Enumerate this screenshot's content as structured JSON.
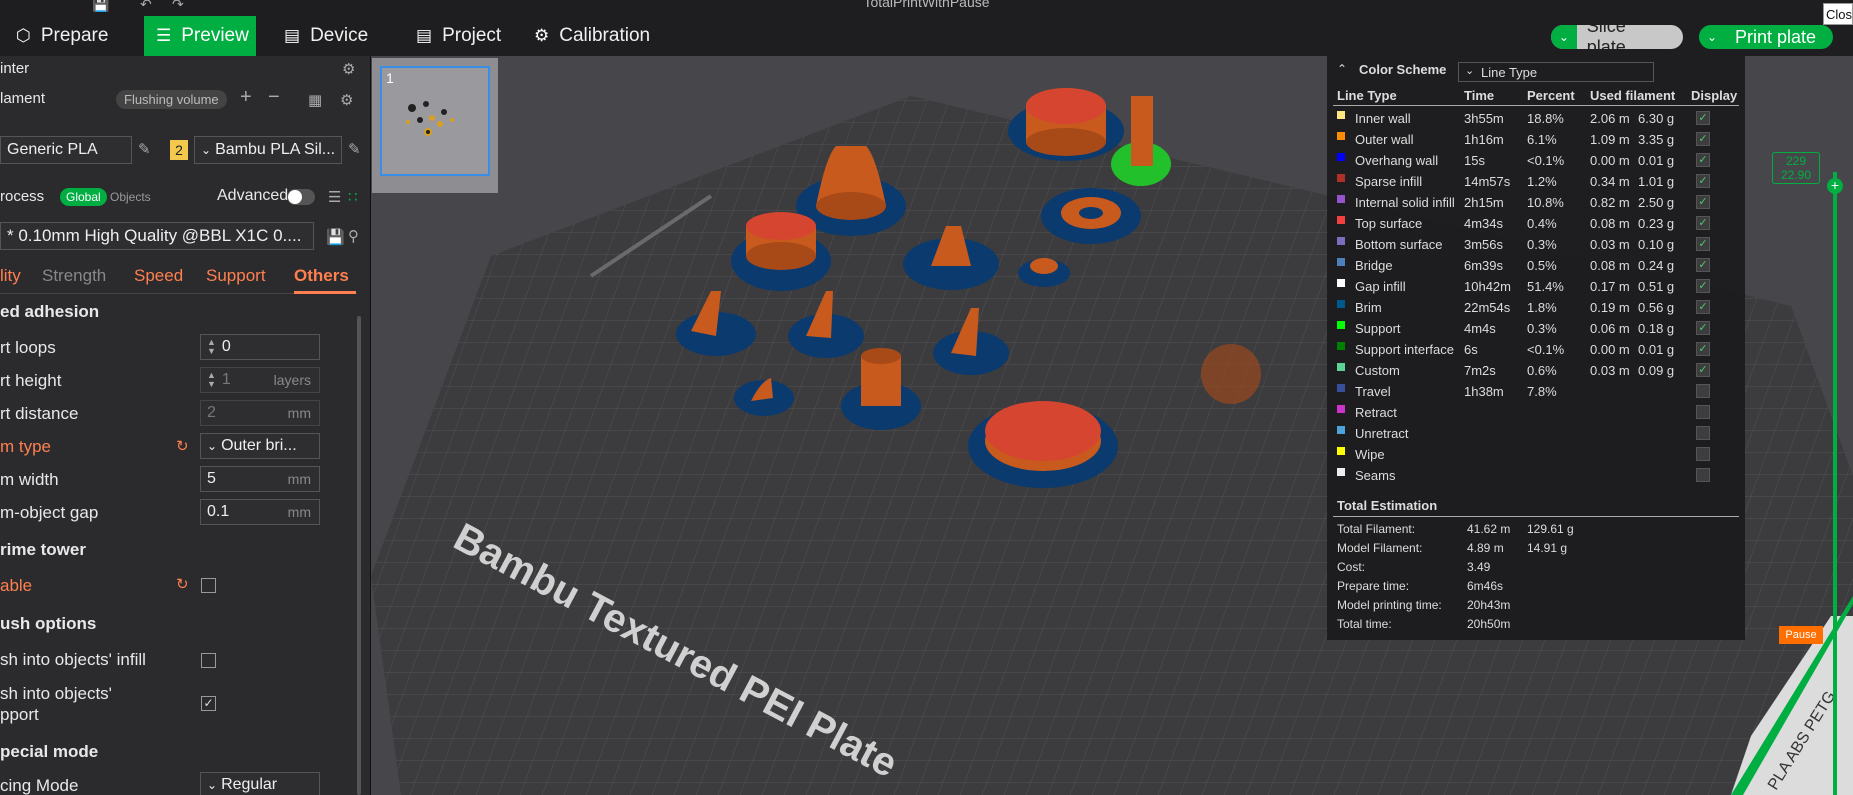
{
  "titlebar": {
    "title": "TotalPrintWithPause",
    "close_tooltip": "Clos"
  },
  "toolbar": {
    "tabs": [
      {
        "label": "Prepare"
      },
      {
        "label": "Preview"
      },
      {
        "label": "Device"
      },
      {
        "label": "Project"
      },
      {
        "label": "Calibration"
      }
    ],
    "slice_plate": "Slice plate",
    "print_plate": "Print plate",
    "accent": "#00ae42"
  },
  "left": {
    "printer_label": "inter",
    "filament_label": "lament",
    "flushing_volume": "Flushing volume",
    "filament1": "Generic PLA",
    "filament2_index": "2",
    "filament2": "Bambu PLA Sil...",
    "process_label": "rocess",
    "global_label": "Global",
    "objects_label": "Objects",
    "advanced_label": "Advanced",
    "profile": "* 0.10mm High Quality @BBL X1C 0....",
    "tabs": [
      "lity",
      "Strength",
      "Speed",
      "Support",
      "Others"
    ],
    "sections": {
      "bed_adhesion": "ed adhesion",
      "prime_tower": "rime tower",
      "flush_options": "ush options",
      "special_mode": "pecial mode"
    },
    "rows": {
      "skirt_loops": {
        "label": "rt loops",
        "value": "0"
      },
      "skirt_height": {
        "label": "rt height",
        "value": "1",
        "unit": "layers"
      },
      "skirt_distance": {
        "label": "rt distance",
        "value": "2",
        "unit": "mm"
      },
      "brim_type": {
        "label": "m type",
        "value": "Outer bri..."
      },
      "brim_width": {
        "label": "m width",
        "value": "5",
        "unit": "mm"
      },
      "brim_gap": {
        "label": "m-object gap",
        "value": "0.1",
        "unit": "mm"
      },
      "enable": {
        "label": "able"
      },
      "flush_infill": {
        "label": "sh into objects' infill"
      },
      "flush_support_1": {
        "label": "sh into objects'"
      },
      "flush_support_2": {
        "label": "pport"
      },
      "slicing_mode": {
        "label": "cing Mode",
        "value": "Regular"
      }
    }
  },
  "viewport": {
    "plate_number": "1",
    "plate_label": "Bambu Textured PEI Plate",
    "side_label": "PLA ABS PETG"
  },
  "legend": {
    "title": "Color Scheme",
    "scheme": "Line Type",
    "columns": [
      "Line Type",
      "Time",
      "Percent",
      "Used filament",
      "Display"
    ],
    "rows": [
      {
        "name": "Inner wall",
        "color": "#ffe680",
        "time": "3h55m",
        "percent": "18.8%",
        "len": "2.06 m",
        "weight": "6.30 g",
        "display": true
      },
      {
        "name": "Outer wall",
        "color": "#ff8c00",
        "time": "1h16m",
        "percent": "6.1%",
        "len": "1.09 m",
        "weight": "3.35 g",
        "display": true
      },
      {
        "name": "Overhang wall",
        "color": "#0000ff",
        "time": "15s",
        "percent": "<0.1%",
        "len": "0.00 m",
        "weight": "0.01 g",
        "display": true
      },
      {
        "name": "Sparse infill",
        "color": "#b03029",
        "time": "14m57s",
        "percent": "1.2%",
        "len": "0.34 m",
        "weight": "1.01 g",
        "display": true
      },
      {
        "name": "Internal solid infill",
        "color": "#9654cc",
        "time": "2h15m",
        "percent": "10.8%",
        "len": "0.82 m",
        "weight": "2.50 g",
        "display": true
      },
      {
        "name": "Top surface",
        "color": "#f04040",
        "time": "4m34s",
        "percent": "0.4%",
        "len": "0.08 m",
        "weight": "0.23 g",
        "display": true
      },
      {
        "name": "Bottom surface",
        "color": "#7a6fbf",
        "time": "3m56s",
        "percent": "0.3%",
        "len": "0.03 m",
        "weight": "0.10 g",
        "display": true
      },
      {
        "name": "Bridge",
        "color": "#4d80ba",
        "time": "6m39s",
        "percent": "0.5%",
        "len": "0.08 m",
        "weight": "0.24 g",
        "display": true
      },
      {
        "name": "Gap infill",
        "color": "#ffffff",
        "time": "10h42m",
        "percent": "51.4%",
        "len": "0.17 m",
        "weight": "0.51 g",
        "display": true
      },
      {
        "name": "Brim",
        "color": "#00598c",
        "time": "22m54s",
        "percent": "1.8%",
        "len": "0.19 m",
        "weight": "0.56 g",
        "display": true
      },
      {
        "name": "Support",
        "color": "#00ff00",
        "time": "4m4s",
        "percent": "0.3%",
        "len": "0.06 m",
        "weight": "0.18 g",
        "display": true
      },
      {
        "name": "Support interface",
        "color": "#008000",
        "time": "6s",
        "percent": "<0.1%",
        "len": "0.00 m",
        "weight": "0.01 g",
        "display": true
      },
      {
        "name": "Custom",
        "color": "#5ed194",
        "time": "7m2s",
        "percent": "0.6%",
        "len": "0.03 m",
        "weight": "0.09 g",
        "display": true
      },
      {
        "name": "Travel",
        "color": "#384d9c",
        "time": "1h38m",
        "percent": "7.8%",
        "len": "",
        "weight": "",
        "display": false
      },
      {
        "name": "Retract",
        "color": "#cc33cc",
        "time": "",
        "percent": "",
        "len": "",
        "weight": "",
        "display": false
      },
      {
        "name": "Unretract",
        "color": "#4ca3d9",
        "time": "",
        "percent": "",
        "len": "",
        "weight": "",
        "display": false
      },
      {
        "name": "Wipe",
        "color": "#ffff00",
        "time": "",
        "percent": "",
        "len": "",
        "weight": "",
        "display": false
      },
      {
        "name": "Seams",
        "color": "#ededed",
        "time": "",
        "percent": "",
        "len": "",
        "weight": "",
        "display": false
      }
    ],
    "total_title": "Total Estimation",
    "totals": [
      {
        "label": "Total Filament:",
        "v1": "41.62 m",
        "v2": "129.61 g"
      },
      {
        "label": "Model Filament:",
        "v1": "4.89 m",
        "v2": "14.91 g"
      },
      {
        "label": "Cost:",
        "v1": "3.49",
        "v2": ""
      },
      {
        "label": "Prepare time:",
        "v1": "6m46s",
        "v2": ""
      },
      {
        "label": "Model printing time:",
        "v1": "20h43m",
        "v2": ""
      },
      {
        "label": "Total time:",
        "v1": "20h50m",
        "v2": ""
      }
    ]
  },
  "slider": {
    "top_layer": "229",
    "top_height": "22.90",
    "pause_label": "Pause"
  }
}
